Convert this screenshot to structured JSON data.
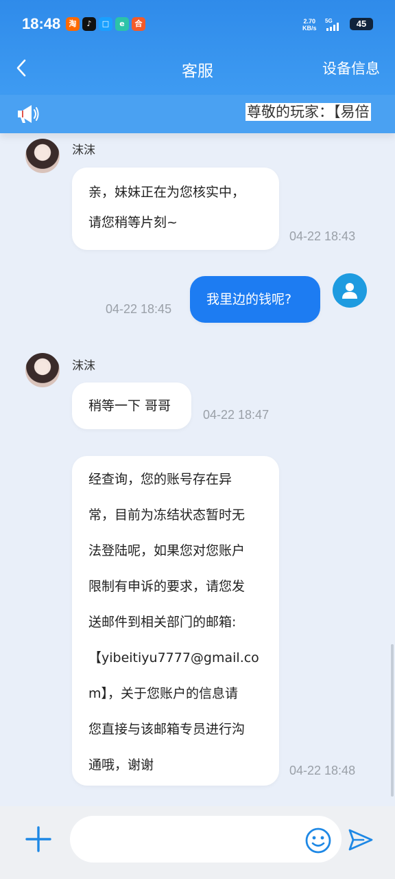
{
  "status_bar": {
    "time": "18:48",
    "net_speed_value": "2.70",
    "net_speed_unit": "KB/s",
    "net_type": "5G",
    "battery": "45",
    "app_badges": [
      "淘",
      "♪",
      "□",
      "e",
      "合"
    ]
  },
  "header": {
    "back_icon": "chevron-left-icon",
    "title": "客服",
    "device_info": "设备信息"
  },
  "notice": {
    "icon": "megaphone-icon",
    "text": "尊敬的玩家：【易倍"
  },
  "messages": [
    {
      "direction": "in",
      "sender": "沫沫",
      "text": "亲，妹妹正在为您核实中，\n请您稍等片刻~",
      "time": "04-22 18:43"
    },
    {
      "direction": "out",
      "text": "我里边的钱呢?",
      "time": "04-22 18:45"
    },
    {
      "direction": "in",
      "sender": "沫沫",
      "text": "稍等一下 哥哥",
      "time": "04-22 18:47"
    },
    {
      "direction": "in",
      "text": "经查询，您的账号存在异\n常，目前为冻结状态暂时无\n法登陆呢，如果您对您账户\n限制有申诉的要求，请您发\n送邮件到相关部门的邮箱:\n【yibeitiyu7777@gmail.co\nm】，关于您账户的信息请\n您直接与该邮箱专员进行沟\n通哦，谢谢",
      "time": "04-22 18:48"
    }
  ],
  "input": {
    "placeholder": "",
    "plus_icon": "plus-icon",
    "emoji_icon": "smiley-icon",
    "send_icon": "send-icon"
  },
  "colors": {
    "header_top": "#2f8bea",
    "notice_bg": "#4aa1f2",
    "outgoing_bubble": "#1d7cf2",
    "chat_bg": "#e9eff9",
    "accent_icon": "#1e9be0"
  }
}
